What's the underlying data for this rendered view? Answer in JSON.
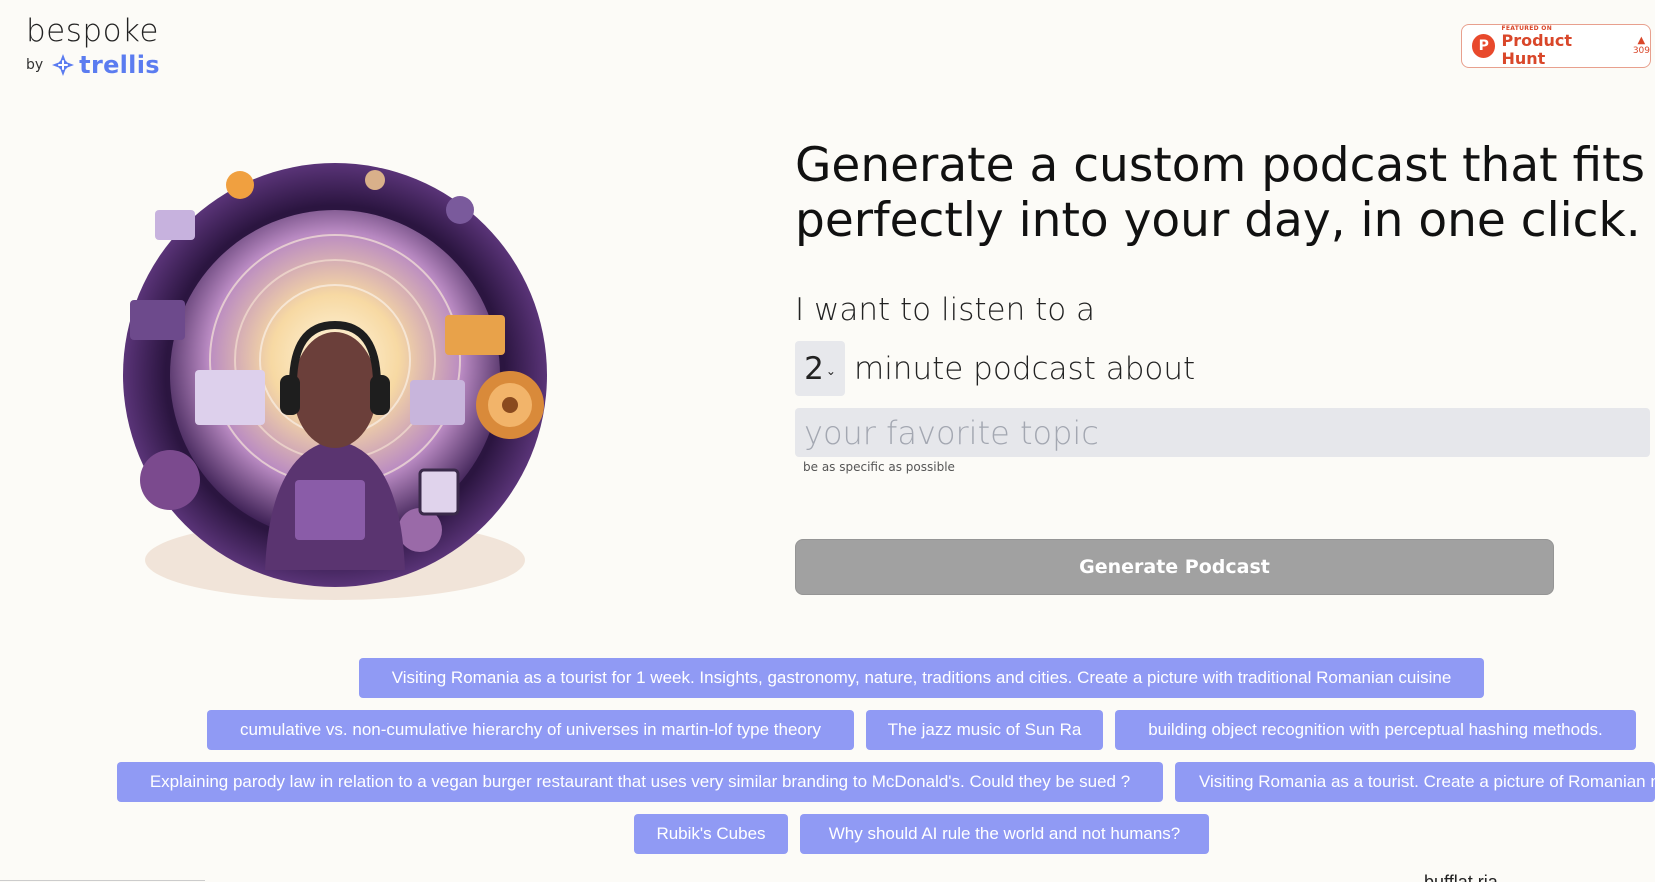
{
  "logo": {
    "word": "bespoke",
    "by": "by",
    "brand": "trellis"
  },
  "product_hunt": {
    "featured": "FEATURED ON",
    "name": "Product Hunt",
    "votes": "309"
  },
  "hero": {
    "headline_line1": "Generate a custom podcast that fits",
    "headline_line2": "perfectly into your day, in one click."
  },
  "form": {
    "intro": "I want to listen to a",
    "duration_value": "2",
    "duration_suffix": "minute podcast about",
    "topic_placeholder": "your favorite topic",
    "topic_hint": "be as specific as possible",
    "generate_label": "Generate Podcast"
  },
  "suggestions": [
    "Visiting Romania as a tourist for 1 week. Insights, gastronomy, nature, traditions and cities. Create a picture with traditional Romanian cuisine",
    "cumulative vs. non-cumulative hierarchy of universes in martin-lof type theory",
    "The jazz music of Sun Ra",
    "building object recognition with perceptual hashing methods.",
    "Explaining parody law in relation to a vegan burger restaurant that uses very similar branding to McDonald's. Could they be sued ?",
    "Visiting Romania as a tourist. Create a picture of Romanian n",
    "Rubik's Cubes",
    "Why should AI rule the world and not humans?"
  ],
  "footer_fragment": "bufflat ria",
  "colors": {
    "background": "#fcfbf7",
    "chip": "#909af4",
    "button_disabled": "#a1a1a1",
    "input": "#e6e7eb",
    "brand_blue": "#5b7cf0",
    "product_hunt": "#d9472a"
  }
}
